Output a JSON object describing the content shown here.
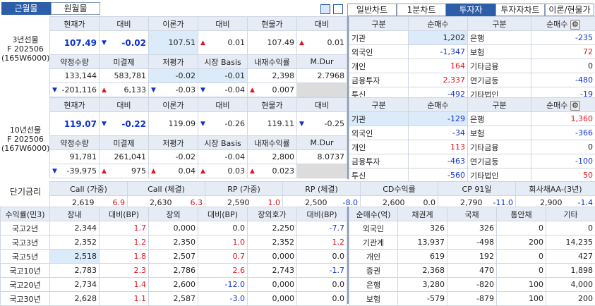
{
  "tabs_left": [
    "근월물",
    "원월물"
  ],
  "tabs_right": [
    "일반차트",
    "1분차트",
    "투자자",
    "투자자차트",
    "이론/현물가"
  ],
  "futures": [
    {
      "title": "3년선물",
      "code": "F 202506",
      "sub": "(165W6000)",
      "h1": [
        "현재가",
        "대비",
        "이론가",
        "대비",
        "현물가",
        "대비"
      ],
      "r1": [
        "107.49",
        "-0.02",
        "107.51",
        "0.01",
        "107.49",
        "0.01"
      ],
      "h2": [
        "약정수량",
        "미결제",
        "저평가",
        "시장 Basis",
        "내재수익률",
        "M.Dur"
      ],
      "r2": [
        "133,144",
        "583,781",
        "-0.02",
        "-0.01",
        "2,398",
        "2.7968"
      ],
      "r3": [
        "-201,116",
        "6,133",
        "-0.03",
        "-0.04",
        "0.007",
        ""
      ]
    },
    {
      "title": "10년선물",
      "code": "F 202506",
      "sub": "(167W6000)",
      "h1": [
        "현재가",
        "대비",
        "이론가",
        "대비",
        "현물가",
        "대비"
      ],
      "r1": [
        "119.07",
        "-0.22",
        "119.09",
        "-0.26",
        "119.11",
        "-0.25"
      ],
      "h2": [
        "약정수량",
        "미결제",
        "저평가",
        "시장 Basis",
        "내재수익률",
        "M.Dur"
      ],
      "r2": [
        "91,781",
        "261,041",
        "-0.02",
        "-0.04",
        "2,800",
        "8.0737"
      ],
      "r3": [
        "-39,975",
        "975",
        "0.04",
        "0.03",
        "0.023",
        ""
      ]
    }
  ],
  "investors": [
    {
      "head": [
        "구분",
        "순매수",
        "구분",
        "순매수"
      ],
      "rows": [
        [
          "기관",
          "1,202",
          "은행",
          "-235"
        ],
        [
          "외국인",
          "-1,347",
          "보험",
          "72"
        ],
        [
          "개인",
          "164",
          "기타금융",
          "0"
        ],
        [
          "금융투자",
          "2,337",
          "연기금등",
          "-480"
        ],
        [
          "투신",
          "-492",
          "기타법인",
          "-19"
        ]
      ]
    },
    {
      "head": [
        "구분",
        "순매수",
        "구분",
        "순매수"
      ],
      "rows": [
        [
          "기관",
          "-129",
          "은행",
          "1,360"
        ],
        [
          "외국인",
          "-34",
          "보험",
          "-366"
        ],
        [
          "개인",
          "113",
          "기타금융",
          "0"
        ],
        [
          "금융투자",
          "-463",
          "연기금등",
          "-100"
        ],
        [
          "투신",
          "-560",
          "기타법인",
          "50"
        ]
      ]
    }
  ],
  "rates": {
    "label": "단기금리",
    "heads": [
      "Call (가중)",
      "Call (체결)",
      "RP (가중)",
      "RP (체결)",
      "CD수익률",
      "CP 91일",
      "회사채AA-(3년)"
    ],
    "vals": [
      [
        "2,619",
        "6.9"
      ],
      [
        "2,630",
        "6.3"
      ],
      [
        "2,590",
        "1.0"
      ],
      [
        "2,500",
        "-8.0"
      ],
      [
        "2,600",
        "0.0"
      ],
      [
        "2,790",
        "-11.0"
      ],
      [
        "2,900",
        "-1.4"
      ]
    ]
  },
  "yields": {
    "head": [
      "수익률(민3)",
      "장내",
      "대비(BP)",
      "장외",
      "대비(BP)",
      "장외호가",
      "대비(BP)"
    ],
    "rows": [
      [
        "국고2년",
        "2,344",
        "1.7",
        "0,000",
        "0.0",
        "2,250",
        "-7.7"
      ],
      [
        "국고3년",
        "2,352",
        "1.2",
        "2,350",
        "1.0",
        "2,352",
        "1.2"
      ],
      [
        "국고5년",
        "2,518",
        "1.8",
        "2,507",
        "0.7",
        "0,000",
        "0.0"
      ],
      [
        "국고10년",
        "2,783",
        "2.3",
        "2,786",
        "2.6",
        "2,743",
        "-1.7"
      ],
      [
        "국고20년",
        "2,734",
        "1.4",
        "2,600",
        "-12.0",
        "0,000",
        "0.0"
      ],
      [
        "국고30년",
        "2,628",
        "1.1",
        "2,587",
        "-3.0",
        "0,000",
        "0.0"
      ]
    ]
  },
  "netbuy": {
    "head": [
      "순매수(억)",
      "채권계",
      "국채",
      "통안채",
      "기타"
    ],
    "rows": [
      [
        "외국인",
        "326",
        "326",
        "0",
        "0"
      ],
      [
        "기관계",
        "13,937",
        "-498",
        "200",
        "14,235"
      ],
      [
        "개인",
        "619",
        "192",
        "0",
        "427"
      ],
      [
        "증권",
        "2,368",
        "470",
        "0",
        "1,898"
      ],
      [
        "은행",
        "3,280",
        "-820",
        "100",
        "4,000"
      ],
      [
        "보험",
        "-579",
        "-879",
        "100",
        "200"
      ]
    ]
  },
  "colors": {
    "up": "#e0141e",
    "down": "#1034c8",
    "accent": "#2d5ea8"
  }
}
